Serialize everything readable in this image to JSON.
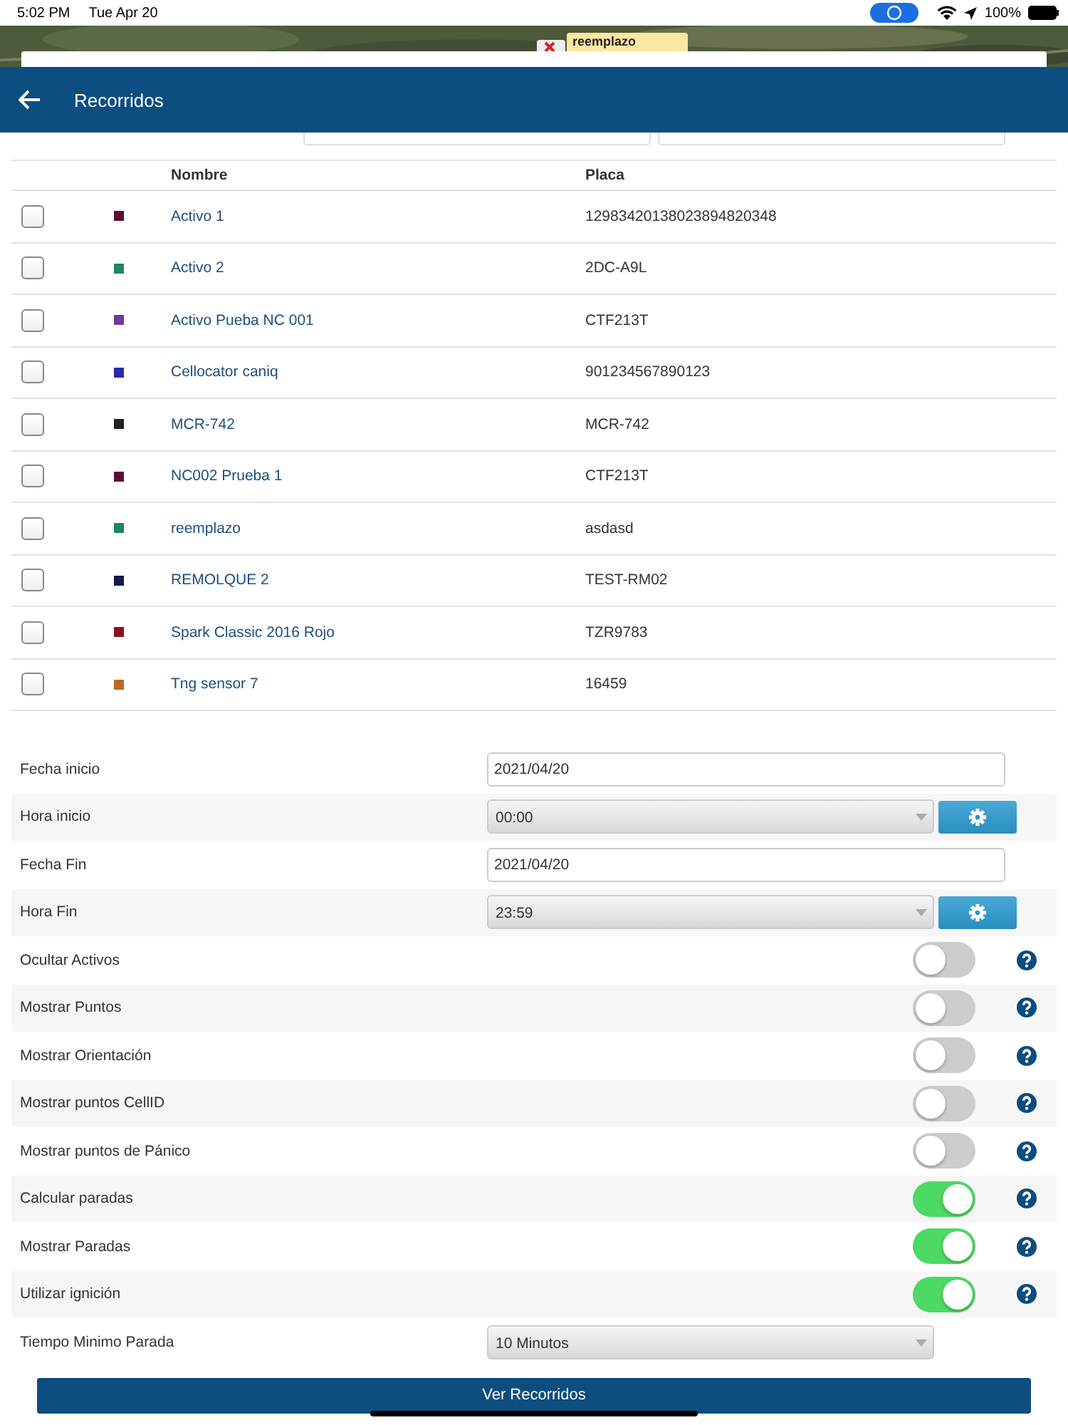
{
  "status_bar": {
    "time": "5:02 PM",
    "date": "Tue Apr 20",
    "battery": "100%"
  },
  "map_marker": {
    "label": "reemplazo"
  },
  "header": {
    "title": "Recorridos"
  },
  "table": {
    "columns": [
      "Nombre",
      "Placa"
    ],
    "rows": [
      {
        "checked": false,
        "color": "#5c1030",
        "name": "Activo 1",
        "plate": "12983420138023894820348"
      },
      {
        "checked": false,
        "color": "#1b8a5c",
        "name": "Activo 2",
        "plate": "2DC-A9L"
      },
      {
        "checked": false,
        "color": "#6b3aa0",
        "name": "Activo Pueba NC 001",
        "plate": "CTF213T"
      },
      {
        "checked": false,
        "color": "#2c2aa8",
        "name": "Cellocator caniq",
        "plate": "901234567890123"
      },
      {
        "checked": false,
        "color": "#222222",
        "name": "MCR-742",
        "plate": "MCR-742"
      },
      {
        "checked": false,
        "color": "#5c1030",
        "name": "NC002 Prueba 1",
        "plate": "CTF213T"
      },
      {
        "checked": false,
        "color": "#1b8a5c",
        "name": "reemplazo",
        "plate": "asdasd"
      },
      {
        "checked": false,
        "color": "#101a50",
        "name": "REMOLQUE 2",
        "plate": "TEST-RM02"
      },
      {
        "checked": false,
        "color": "#8a1222",
        "name": "Spark Classic 2016 Rojo",
        "plate": "TZR9783"
      },
      {
        "checked": false,
        "color": "#c4661f",
        "name": "Tng sensor 7",
        "plate": "16459"
      }
    ]
  },
  "form": [
    {
      "kind": "date",
      "label": "Fecha inicio",
      "value": "2021/04/20"
    },
    {
      "kind": "time",
      "label": "Hora inicio",
      "value": "00:00"
    },
    {
      "kind": "date",
      "label": "Fecha Fin",
      "value": "2021/04/20"
    },
    {
      "kind": "time",
      "label": "Hora Fin",
      "value": "23:59"
    },
    {
      "kind": "toggle",
      "label": "Ocultar Activos",
      "on": false
    },
    {
      "kind": "toggle",
      "label": "Mostrar Puntos",
      "on": false
    },
    {
      "kind": "toggle",
      "label": "Mostrar Orientación",
      "on": false
    },
    {
      "kind": "toggle",
      "label": "Mostrar puntos CellID",
      "on": false
    },
    {
      "kind": "toggle",
      "label": "Mostrar puntos de Pánico",
      "on": false
    },
    {
      "kind": "toggle",
      "label": "Calcular paradas",
      "on": true
    },
    {
      "kind": "toggle",
      "label": "Mostrar Paradas",
      "on": true
    },
    {
      "kind": "toggle",
      "label": "Utilizar ignición",
      "on": true
    },
    {
      "kind": "select",
      "label": "Tiempo Minimo Parada",
      "value": "10 Minutos"
    }
  ],
  "submit_button": "Ver Recorridos"
}
